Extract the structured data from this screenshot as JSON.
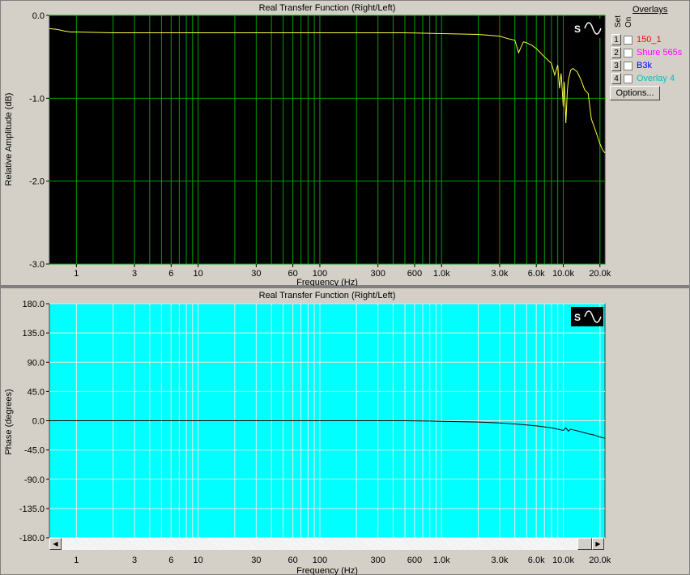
{
  "top_chart": {
    "title": "Real Transfer Function (Right/Left)",
    "ylabel": "Relative Amplitude (dB)",
    "xlabel": "Frequency (Hz)",
    "yticks": [
      "0.0",
      "-1.0",
      "-2.0",
      "-3.0"
    ],
    "xticks": [
      "1",
      "3",
      "6",
      "10",
      "30",
      "60",
      "100",
      "300",
      "600",
      "1.0k",
      "3.0k",
      "6.0k",
      "10.0k",
      "20.0k"
    ],
    "background": "#000000",
    "grid_color": "#00a000",
    "line_color": "#ffff40"
  },
  "bottom_chart": {
    "title": "Real Transfer Function (Right/Left)",
    "ylabel": "Phase (degrees)",
    "xlabel": "Frequency (Hz)",
    "yticks": [
      "180.0",
      "135.0",
      "90.0",
      "45.0",
      "0.0",
      "-45.0",
      "-90.0",
      "-135.0",
      "-180.0"
    ],
    "xticks": [
      "1",
      "3",
      "6",
      "10",
      "30",
      "60",
      "100",
      "300",
      "600",
      "1.0k",
      "3.0k",
      "6.0k",
      "10.0k",
      "20.0k"
    ],
    "background": "#00ffff",
    "grid_color": "#e8e8e8",
    "line_color": "#000000"
  },
  "overlays": {
    "title": "Overlays",
    "set_label": "Set",
    "on_label": "On",
    "items": [
      {
        "num": "1",
        "name": "150_1",
        "color": "#ff0000"
      },
      {
        "num": "2",
        "name": "Shure 565s",
        "color": "#ff00ff"
      },
      {
        "num": "3",
        "name": "B3k",
        "color": "#0000ff"
      },
      {
        "num": "4",
        "name": "Overlay 4",
        "color": "#00c0c0"
      }
    ],
    "options_label": "Options..."
  },
  "chart_data": [
    {
      "type": "line",
      "title": "Real Transfer Function (Right/Left)",
      "xlabel": "Frequency (Hz)",
      "ylabel": "Relative Amplitude (dB)",
      "xscale": "log",
      "xlim": [
        0.6,
        22000
      ],
      "ylim": [
        -3.0,
        0.0
      ],
      "grid": true,
      "series": [
        {
          "x": [
            0.6,
            0.7,
            0.8,
            0.9,
            1,
            2,
            5,
            10,
            50,
            100,
            500,
            1000,
            2000,
            3000,
            3500,
            4000,
            4300,
            4500,
            4700,
            5000,
            5500,
            6000,
            7000,
            8000,
            8500,
            9000,
            9300,
            9600,
            10000,
            10200,
            10500,
            10800,
            11000,
            11500,
            12000,
            13000,
            14000,
            15000,
            16000,
            17000,
            18000,
            19000,
            20000,
            21000,
            22000
          ],
          "y": [
            -0.16,
            -0.17,
            -0.19,
            -0.2,
            -0.2,
            -0.21,
            -0.21,
            -0.21,
            -0.21,
            -0.21,
            -0.21,
            -0.22,
            -0.23,
            -0.25,
            -0.28,
            -0.3,
            -0.45,
            -0.38,
            -0.32,
            -0.33,
            -0.36,
            -0.4,
            -0.5,
            -0.58,
            -0.72,
            -0.6,
            -0.88,
            -0.7,
            -1.1,
            -0.8,
            -1.3,
            -0.9,
            -0.78,
            -0.66,
            -0.64,
            -0.68,
            -0.78,
            -0.9,
            -0.94,
            -1.25,
            -1.35,
            -1.45,
            -1.55,
            -1.62,
            -1.66
          ]
        }
      ]
    },
    {
      "type": "line",
      "title": "Real Transfer Function (Right/Left)",
      "xlabel": "Frequency (Hz)",
      "ylabel": "Phase (degrees)",
      "xscale": "log",
      "xlim": [
        0.6,
        22000
      ],
      "ylim": [
        -180,
        180
      ],
      "grid": true,
      "series": [
        {
          "x": [
            0.6,
            1,
            10,
            100,
            500,
            800,
            1000,
            2000,
            3000,
            4000,
            5000,
            6000,
            7000,
            8000,
            9000,
            10000,
            10500,
            11000,
            11500,
            12000,
            14000,
            16000,
            18000,
            20000,
            22000
          ],
          "y": [
            0,
            0,
            0,
            0,
            0,
            -0.5,
            -1,
            -2,
            -3.5,
            -5,
            -6.5,
            -8,
            -9.5,
            -11,
            -13,
            -15,
            -11,
            -16,
            -13,
            -14,
            -17,
            -20,
            -22,
            -25,
            -27
          ]
        }
      ]
    }
  ]
}
